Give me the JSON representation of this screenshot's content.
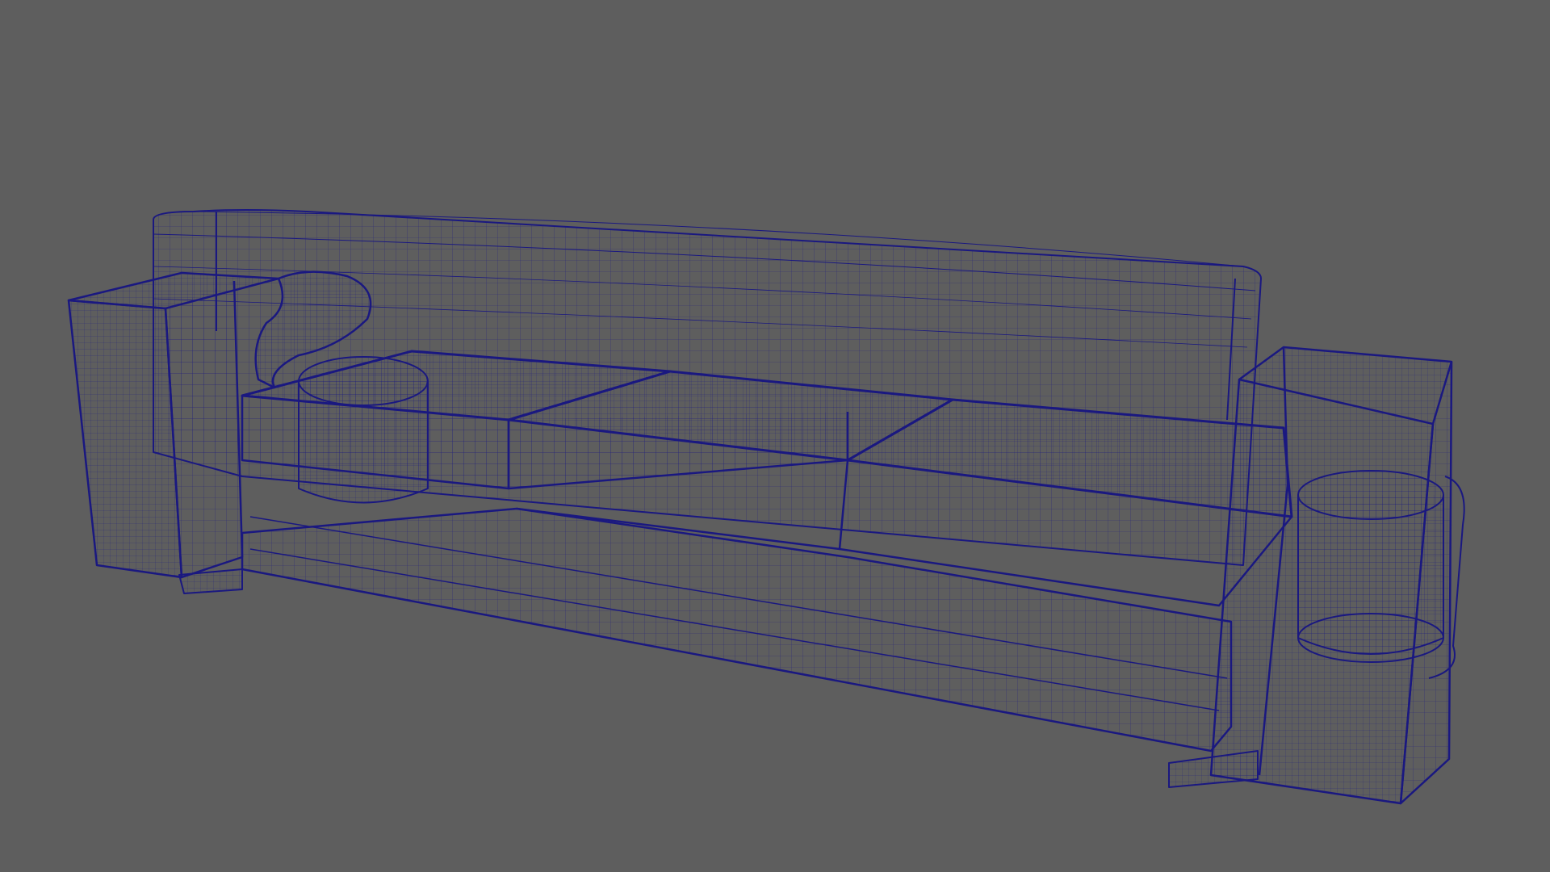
{
  "viewport": {
    "background": "#5e5e5e",
    "wire_color": "#1a1880",
    "display_mode": "wireframe"
  },
  "model": {
    "object": "sofa",
    "parts": [
      "back",
      "left-arm-block",
      "right-arm-block",
      "seat-cushion-left",
      "seat-cushion-middle",
      "seat-cushion-right",
      "base",
      "left-foot",
      "right-foot",
      "left-curved-pillow",
      "left-bolster",
      "right-bolster"
    ]
  }
}
